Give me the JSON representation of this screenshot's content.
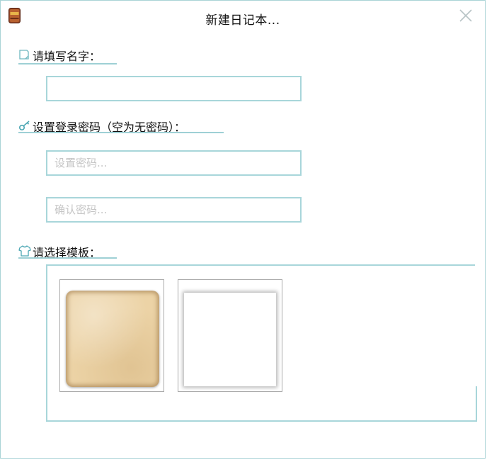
{
  "window": {
    "title": "新建日记本...",
    "close_symbol": "×"
  },
  "name_section": {
    "label": "请填写名字：",
    "icon": "note-icon",
    "value": ""
  },
  "password_section": {
    "label": "设置登录密码（空为无密码）：",
    "icon": "key-icon",
    "password_placeholder": "设置密码...",
    "confirm_placeholder": "确认密码..."
  },
  "template_section": {
    "label": "请选择模板：",
    "icon": "shirt-icon",
    "templates": [
      {
        "name": "parchment-template",
        "color": "#ecd3a6"
      },
      {
        "name": "white-template",
        "color": "#ffffff"
      }
    ]
  },
  "colors": {
    "accent_border": "#a8d6da",
    "underline": "#9ed0d5",
    "app_icon": "#9a4a2a"
  }
}
